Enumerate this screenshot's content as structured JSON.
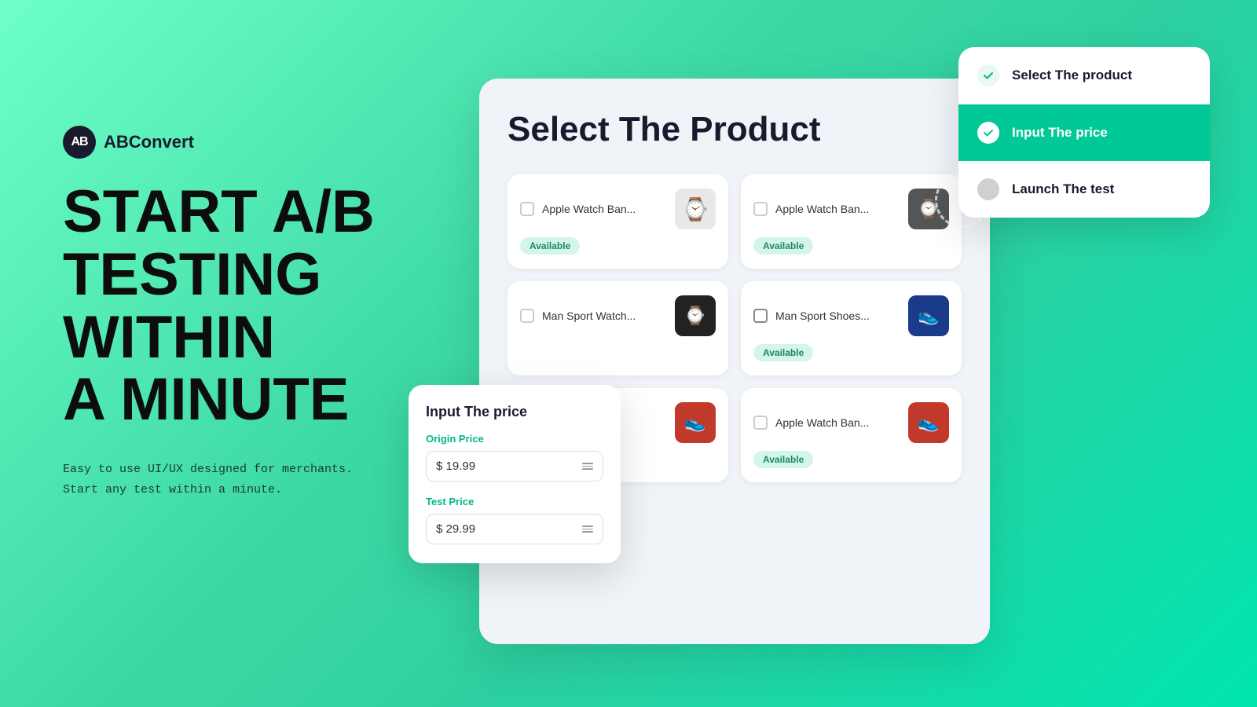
{
  "brand": {
    "logo_text": "AB",
    "name": "ABConvert"
  },
  "headline": {
    "line1": "START A/B",
    "line2": "TESTING",
    "line3": "WITHIN",
    "line4": "A MINUTE"
  },
  "subtitle": {
    "line1": "Easy to use UI/UX designed for merchants.",
    "line2": "Start any test within a minute."
  },
  "panel": {
    "title": "Select The  Product"
  },
  "products": [
    {
      "name": "Apple Watch Ban...",
      "badge": "Available",
      "emoji": "⌚"
    },
    {
      "name": "Apple Watch Ban...",
      "badge": "Available",
      "emoji": "⌚"
    },
    {
      "name": "Man Sport Watch...",
      "badge": "",
      "emoji": "⌚"
    },
    {
      "name": "Man Sport Shoes...",
      "badge": "Available",
      "emoji": "👟"
    },
    {
      "name": "...",
      "badge": "",
      "emoji": "👟"
    },
    {
      "name": "Apple Watch Ban...",
      "badge": "Available",
      "emoji": "👟"
    }
  ],
  "input_price_card": {
    "title": "Input The price",
    "origin_label": "Origin Price",
    "origin_value": "$ 19.99",
    "test_label": "Test Price",
    "test_value": "$ 29.99"
  },
  "steps": [
    {
      "label": "Select The product",
      "state": "done"
    },
    {
      "label": "Input The price",
      "state": "active"
    },
    {
      "label": "Launch The test",
      "state": "pending"
    }
  ]
}
